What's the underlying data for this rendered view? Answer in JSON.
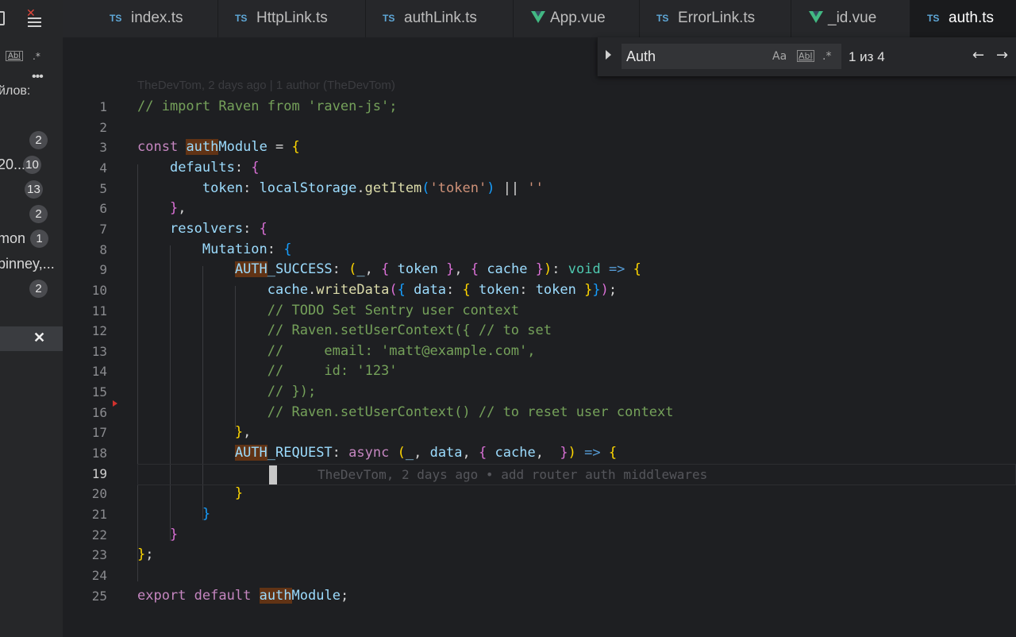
{
  "sidebar": {
    "heading": "йлов:",
    "rows": [
      {
        "label": "",
        "badge": "2"
      },
      {
        "label": "20...",
        "badge": "10"
      },
      {
        "label": "",
        "badge": "13"
      },
      {
        "label": "",
        "badge": "2"
      },
      {
        "label": "mon",
        "badge": "1"
      },
      {
        "label": "pinney,...",
        "badge": ""
      },
      {
        "label": "",
        "badge": "2"
      }
    ],
    "close_glyph": "✕",
    "menu_glyph": "✕",
    "case_glyph": "Abl",
    "regex_glyph": ".*",
    "more_glyph": "•••"
  },
  "tabs": [
    {
      "icon": "TS",
      "label": "index.ts",
      "active": false
    },
    {
      "icon": "TS",
      "label": "HttpLink.ts",
      "active": false
    },
    {
      "icon": "TS",
      "label": "authLink.ts",
      "active": false
    },
    {
      "icon": "vue",
      "label": "App.vue",
      "active": false
    },
    {
      "icon": "TS",
      "label": "ErrorLink.ts",
      "active": false
    },
    {
      "icon": "vue",
      "label": "_id.vue",
      "active": false
    },
    {
      "icon": "TS",
      "label": "auth.ts",
      "active": true
    }
  ],
  "find": {
    "value": "Auth",
    "match_case": "Aa",
    "whole_word": "Abl",
    "regex": ".*",
    "count": "1 из 4",
    "prev": "←",
    "next": "→"
  },
  "editor": {
    "blame_header": "TheDevTom, 2 days ago | 1 author (TheDevTom)",
    "inline_blame": "TheDevTom, 2 days ago • add router auth middlewares",
    "current_line": 19,
    "lines": [
      "// import Raven from 'raven-js';",
      "",
      "const authModule = {",
      "    defaults: {",
      "        token: localStorage.getItem('token') || ''",
      "    },",
      "    resolvers: {",
      "        Mutation: {",
      "            AUTH_SUCCESS: (_, { token }, { cache }): void => {",
      "                cache.writeData({ data: { token: token }});",
      "                // TODO Set Sentry user context",
      "                // Raven.setUserContext({ // to set",
      "                //     email: 'matt@example.com',",
      "                //     id: '123'",
      "                // });",
      "                // Raven.setUserContext() // to reset user context",
      "            },",
      "            AUTH_REQUEST: async (_, data, { cache,  }) => {",
      "",
      "            }",
      "        }",
      "    }",
      "};",
      "",
      "export default authModule;"
    ]
  },
  "colors": {
    "background": "#1e1f22",
    "match_highlight": "#613315",
    "comment": "#75a15a",
    "keyword": "#c586c0",
    "ts_icon": "#5fa8d8",
    "vue_icon": "#42b883"
  }
}
